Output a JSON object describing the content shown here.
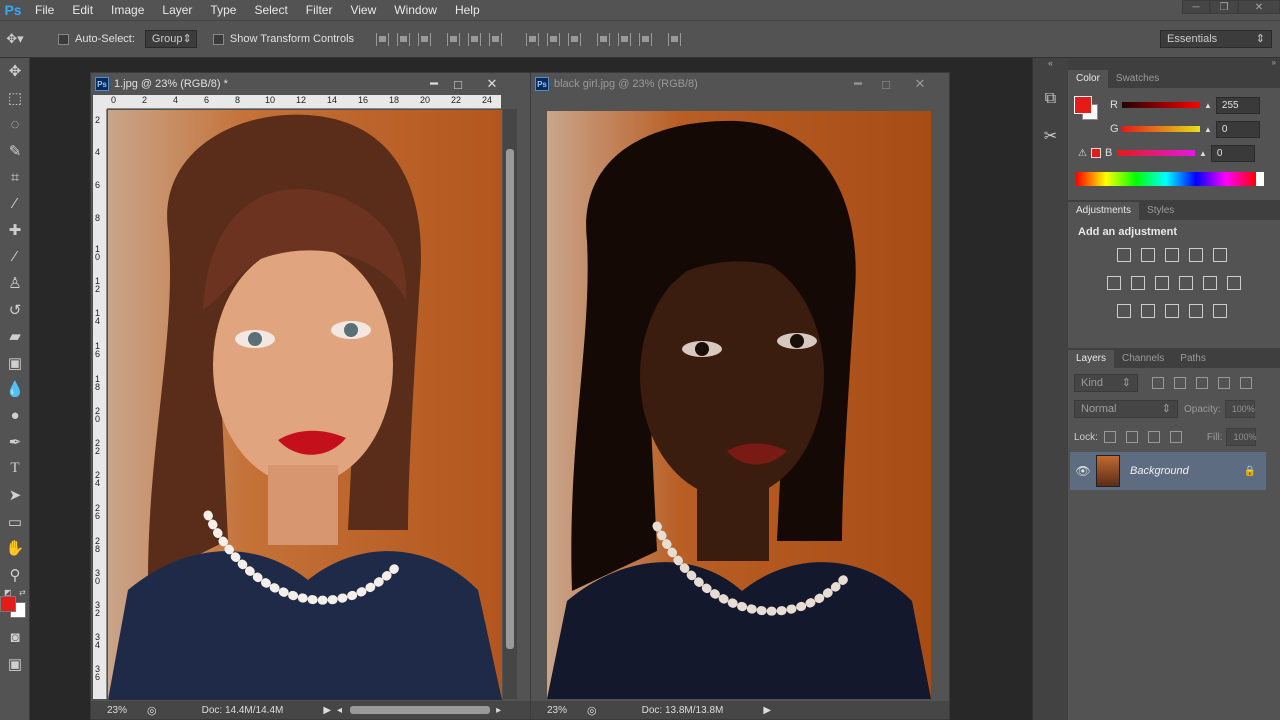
{
  "menubar": {
    "logo": "Ps",
    "items": [
      "File",
      "Edit",
      "Image",
      "Layer",
      "Type",
      "Select",
      "Filter",
      "View",
      "Window",
      "Help"
    ],
    "window_controls": [
      "─",
      "❐",
      "✕"
    ]
  },
  "options_bar": {
    "auto_select_label": "Auto-Select:",
    "auto_select_value": "Group",
    "show_transform_label": "Show Transform Controls",
    "workspace_value": "Essentials"
  },
  "documents": [
    {
      "title": "1.jpg @ 23% (RGB/8) *",
      "zoom": "23%",
      "doc_size": "Doc: 14.4M/14.4M",
      "ruler_h": [
        "0",
        "2",
        "4",
        "6",
        "8",
        "10",
        "12",
        "14",
        "16",
        "18",
        "20",
        "22",
        "24"
      ],
      "ruler_v": [
        "2",
        "4",
        "6",
        "8",
        "1 0",
        "1 2",
        "1 4",
        "1 6",
        "1 8",
        "2 0",
        "2 2",
        "2 4",
        "2 6",
        "2 8",
        "3 0",
        "3 2",
        "3 4",
        "3 6"
      ]
    },
    {
      "title": "black girl.jpg @ 23% (RGB/8)",
      "zoom": "23%",
      "doc_size": "Doc: 13.8M/13.8M"
    }
  ],
  "color_panel": {
    "tabs": [
      "Color",
      "Swatches"
    ],
    "channels": [
      {
        "label": "R",
        "value": "255"
      },
      {
        "label": "G",
        "value": "0"
      },
      {
        "label": "B",
        "value": "0"
      }
    ],
    "foreground": "#e41b17"
  },
  "adjustments_panel": {
    "tabs": [
      "Adjustments",
      "Styles"
    ],
    "heading": "Add an adjustment"
  },
  "layers_panel": {
    "tabs": [
      "Layers",
      "Channels",
      "Paths"
    ],
    "filter_label": "Kind",
    "blend_mode": "Normal",
    "opacity_label": "Opacity:",
    "opacity_value": "100%",
    "lock_label": "Lock:",
    "fill_label": "Fill:",
    "fill_value": "100%",
    "layers": [
      {
        "name": "Background"
      }
    ]
  }
}
